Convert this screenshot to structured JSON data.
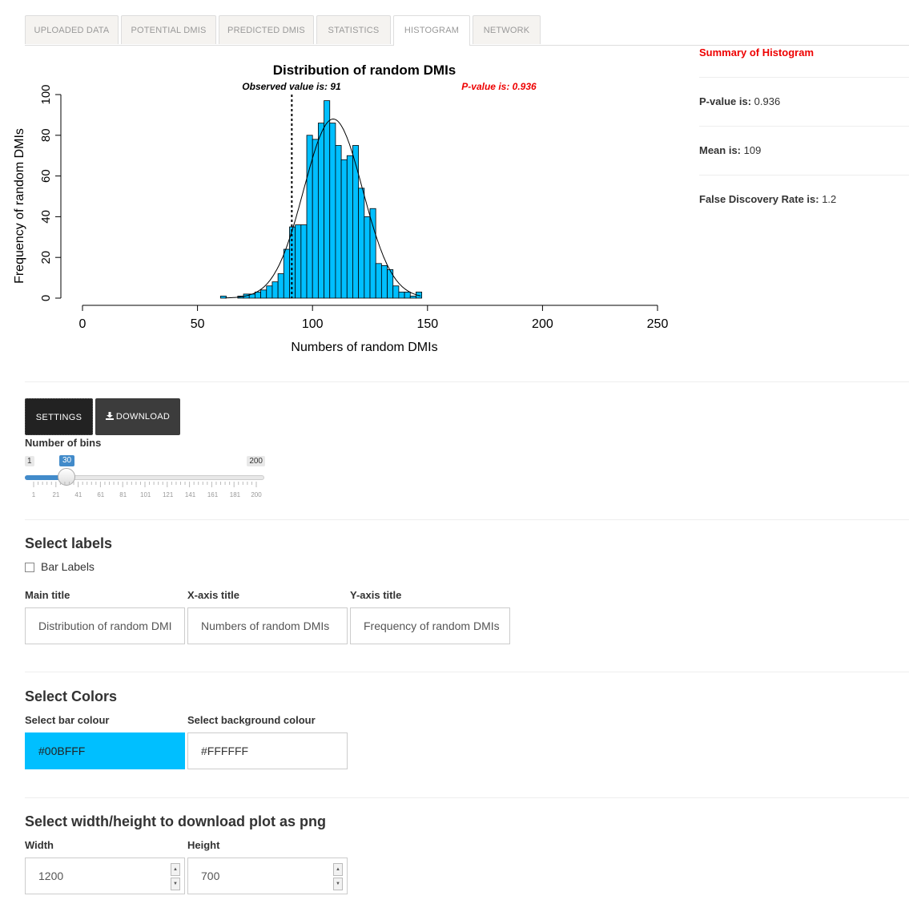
{
  "tabs": [
    "UPLOADED DATA",
    "POTENTIAL DMIS",
    "PREDICTED DMIS",
    "STATISTICS",
    "HISTOGRAM",
    "NETWORK"
  ],
  "active_tab": "HISTOGRAM",
  "summary": {
    "title": "Summary of Histogram",
    "pvalue_label": "P-value is:",
    "pvalue": "0.936",
    "mean_label": "Mean is:",
    "mean": "109",
    "fdr_label": "False Discovery Rate is:",
    "fdr": "1.2"
  },
  "chart_data": {
    "type": "bar",
    "title": "Distribution of random DMIs",
    "xlabel": "Numbers of random DMIs",
    "ylabel": "Frequency of random DMIs",
    "xlim": [
      0,
      250
    ],
    "ylim": [
      0,
      100
    ],
    "xticks": [
      0,
      50,
      100,
      150,
      200,
      250
    ],
    "yticks": [
      0,
      20,
      40,
      60,
      80,
      100
    ],
    "bin_width": 2.5,
    "bin_starts": [
      60,
      62.5,
      65,
      67.5,
      70,
      72.5,
      75,
      77.5,
      80,
      82.5,
      85,
      87.5,
      90,
      92.5,
      95,
      97.5,
      100,
      102.5,
      105,
      107.5,
      110,
      112.5,
      115,
      117.5,
      120,
      122.5,
      125,
      127.5,
      130,
      132.5,
      135,
      137.5,
      140,
      142.5,
      145
    ],
    "values": [
      1,
      0,
      0,
      1,
      2,
      2,
      3,
      4,
      6,
      8,
      12,
      24,
      35,
      36,
      36,
      80,
      78,
      86,
      97,
      86,
      75,
      68,
      70,
      75,
      54,
      40,
      44,
      17,
      16,
      14,
      6,
      3,
      3,
      1,
      3
    ],
    "bar_color": "#00BFFF",
    "annotations": {
      "observed_label": "Observed value is:",
      "observed_value": "91",
      "observed_x": 91,
      "pvalue_label": "P-value is: 0.936"
    },
    "curve": {
      "type": "normal",
      "mean": 109,
      "sd": 12.8,
      "peak": 88
    }
  },
  "buttons": {
    "settings": "SETTINGS",
    "download": "DOWNLOAD"
  },
  "bins": {
    "label": "Number of bins",
    "min": "1",
    "max": "200",
    "value": "30",
    "ticks": [
      "1",
      "21",
      "41",
      "61",
      "81",
      "101",
      "121",
      "141",
      "161",
      "181",
      "200"
    ]
  },
  "labels_section": {
    "heading": "Select labels",
    "bar_labels": "Bar Labels",
    "main_title_label": "Main title",
    "main_title_value": "Distribution of random DMI",
    "x_title_label": "X-axis title",
    "x_title_value": "Numbers of random DMIs",
    "y_title_label": "Y-axis title",
    "y_title_value": "Frequency of random DMIs"
  },
  "colors_section": {
    "heading": "Select Colors",
    "bar_label": "Select bar colour",
    "bar_value": "#00BFFF",
    "bg_label": "Select background colour",
    "bg_value": "#FFFFFF"
  },
  "size_section": {
    "heading": "Select width/height to download plot as png",
    "width_label": "Width",
    "width_value": "1200",
    "height_label": "Height",
    "height_value": "700"
  }
}
